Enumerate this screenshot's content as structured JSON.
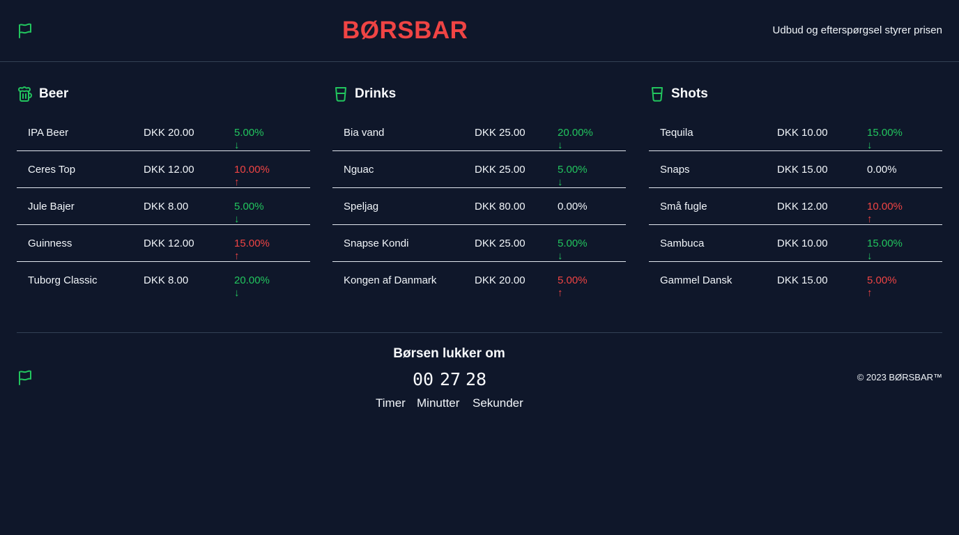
{
  "header": {
    "brand": "BØRSBAR",
    "tagline": "Udbud og efterspørgsel styrer prisen",
    "flag_icon": "flag-icon"
  },
  "colors": {
    "background": "#0f172a",
    "brand": "#ef4444",
    "accent": "#22c55e",
    "price_up": "#ef4444",
    "price_down": "#22c55e"
  },
  "categories": [
    {
      "title": "Beer",
      "icon": "beer-mug-icon",
      "items": [
        {
          "name": "IPA Beer",
          "price": "DKK 20.00",
          "change": "5.00%",
          "direction": "down"
        },
        {
          "name": "Ceres Top",
          "price": "DKK 12.00",
          "change": "10.00%",
          "direction": "up"
        },
        {
          "name": "Jule Bajer",
          "price": "DKK 8.00",
          "change": "5.00%",
          "direction": "down"
        },
        {
          "name": "Guinness",
          "price": "DKK 12.00",
          "change": "15.00%",
          "direction": "up"
        },
        {
          "name": "Tuborg Classic",
          "price": "DKK 8.00",
          "change": "20.00%",
          "direction": "down"
        }
      ]
    },
    {
      "title": "Drinks",
      "icon": "glass-icon",
      "items": [
        {
          "name": "Bia vand",
          "price": "DKK 25.00",
          "change": "20.00%",
          "direction": "down"
        },
        {
          "name": "Nguac",
          "price": "DKK 25.00",
          "change": "5.00%",
          "direction": "down"
        },
        {
          "name": "Speljag",
          "price": "DKK 80.00",
          "change": "0.00%",
          "direction": "flat"
        },
        {
          "name": "Snapse Kondi",
          "price": "DKK 25.00",
          "change": "5.00%",
          "direction": "down"
        },
        {
          "name": "Kongen af Danmark",
          "price": "DKK 20.00",
          "change": "5.00%",
          "direction": "up"
        }
      ]
    },
    {
      "title": "Shots",
      "icon": "glass-icon",
      "items": [
        {
          "name": "Tequila",
          "price": "DKK 10.00",
          "change": "15.00%",
          "direction": "down"
        },
        {
          "name": "Snaps",
          "price": "DKK 15.00",
          "change": "0.00%",
          "direction": "flat"
        },
        {
          "name": "Små fugle",
          "price": "DKK 12.00",
          "change": "10.00%",
          "direction": "up"
        },
        {
          "name": "Sambuca",
          "price": "DKK 10.00",
          "change": "15.00%",
          "direction": "down"
        },
        {
          "name": "Gammel Dansk",
          "price": "DKK 15.00",
          "change": "5.00%",
          "direction": "up"
        }
      ]
    }
  ],
  "countdown": {
    "title": "Børsen lukker om",
    "hours": "00",
    "minutes": "27",
    "seconds": "28",
    "hours_label": "Timer",
    "minutes_label": "Minutter",
    "seconds_label": "Sekunder"
  },
  "footer": {
    "copyright": "© 2023 BØRSBAR™"
  }
}
